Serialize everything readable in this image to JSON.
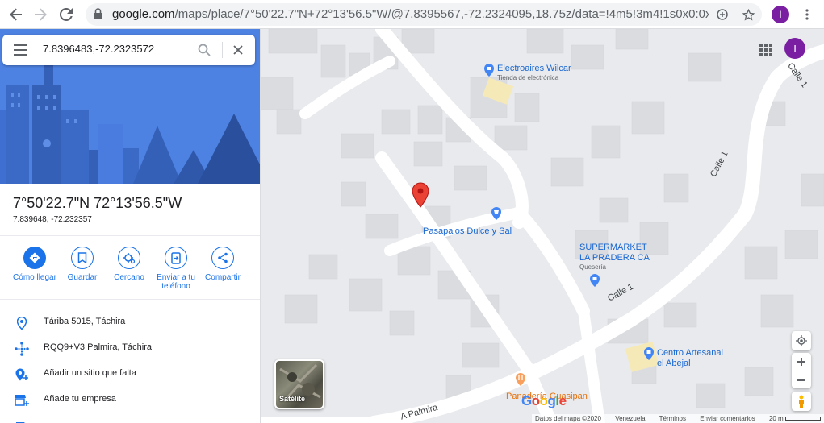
{
  "browser": {
    "url_host": "google.com",
    "url_path": "/maps/place/7°50'22.7\"N+72°13'56.5\"W/@7.8395567,-72.2324095,18.75z/data=!4m5!3m4!1s0x0:0x0!8m...",
    "profile_initial": "I"
  },
  "search": {
    "query": "7.8396483,-72.2323572"
  },
  "place": {
    "title": "7°50'22.7\"N 72°13'56.5\"W",
    "coords": "7.839648, -72.232357"
  },
  "actions": [
    {
      "label": "Cómo llegar",
      "icon": "directions-icon"
    },
    {
      "label": "Guardar",
      "icon": "bookmark-icon"
    },
    {
      "label": "Cercano",
      "icon": "nearby-icon"
    },
    {
      "label": "Enviar a tu teléfono",
      "icon": "send-to-phone-icon"
    },
    {
      "label": "Compartir",
      "icon": "share-icon"
    }
  ],
  "info_rows": [
    {
      "text": "Táriba 5015, Táchira",
      "icon": "location-pin-icon"
    },
    {
      "text": "RQQ9+V3 Palmira, Táchira",
      "icon": "plus-code-icon"
    },
    {
      "text": "Añadir un sitio que falta",
      "icon": "add-place-icon"
    },
    {
      "text": "Añade tu empresa",
      "icon": "business-icon"
    }
  ],
  "map": {
    "avatar_initial": "I",
    "pois": [
      {
        "name": "Electroaires Wilcar",
        "sub": "Tienda de electrónica"
      },
      {
        "name": "Pasapalos Dulce y Sal"
      },
      {
        "name": "SUPERMARKET",
        "name2": "LA PRADERA CA",
        "sub": "Quesería"
      },
      {
        "name": "Centro Artesanal",
        "name2": "el Abejal"
      },
      {
        "name": "Panadería Guasipan"
      }
    ],
    "streets": [
      "Calle 1",
      "Calle 1",
      "Calle 1",
      "A Palmira"
    ],
    "satellite_label": "Satélite",
    "attribution": {
      "data": "Datos del mapa ©2020",
      "country": "Venezuela",
      "terms": "Términos",
      "feedback": "Enviar comentarios",
      "scale": "20 m"
    },
    "colors": {
      "marker": "#ea4335",
      "poi_blue": "#4285f4",
      "poi_orange": "#f9a05e"
    }
  }
}
